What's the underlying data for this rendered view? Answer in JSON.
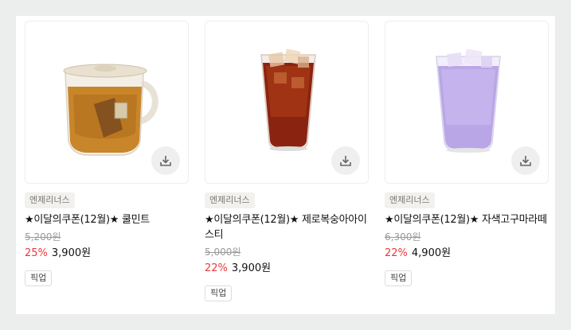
{
  "products": [
    {
      "brand": "엔제리너스",
      "title": "★이달의쿠폰(12월)★ 쿨민트",
      "original_price": "5,200원",
      "discount": "25%",
      "price": "3,900원",
      "tag": "픽업",
      "image_icon": "tea-cup-icon",
      "download_icon": "download-icon"
    },
    {
      "brand": "엔제리너스",
      "title": "★이달의쿠폰(12월)★ 제로복숭아아이스티",
      "original_price": "5,000원",
      "discount": "22%",
      "price": "3,900원",
      "tag": "픽업",
      "image_icon": "iced-tea-icon",
      "download_icon": "download-icon"
    },
    {
      "brand": "엔제리너스",
      "title": "★이달의쿠폰(12월)★ 자색고구마라떼",
      "original_price": "6,300원",
      "discount": "22%",
      "price": "4,900원",
      "tag": "픽업",
      "image_icon": "purple-latte-icon",
      "download_icon": "download-icon"
    }
  ],
  "colors": {
    "discount": "#e8383d",
    "background": "#eceeed"
  }
}
